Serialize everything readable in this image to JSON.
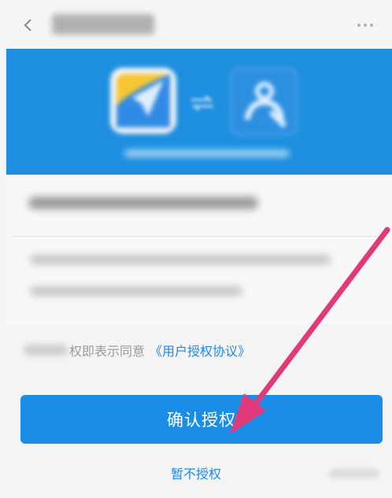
{
  "header": {
    "title": "",
    "back_icon": "chevron-left-icon",
    "more_icon": "more-icon"
  },
  "banner": {
    "background": "#1e8fe0",
    "caption": ""
  },
  "content": {
    "auth_request_text": "",
    "permissions": [
      "",
      ""
    ]
  },
  "agreement": {
    "blurred_prefix": "",
    "text": "权即表示同意",
    "link": "《用户授权协议》"
  },
  "actions": {
    "confirm_label": "确认授权",
    "decline_label": "暂不授权"
  },
  "footer": {
    "watermark": ""
  },
  "colors": {
    "accent": "#1a8ee6",
    "link": "#1e88e5",
    "annotation_arrow": "#e03a7a"
  }
}
